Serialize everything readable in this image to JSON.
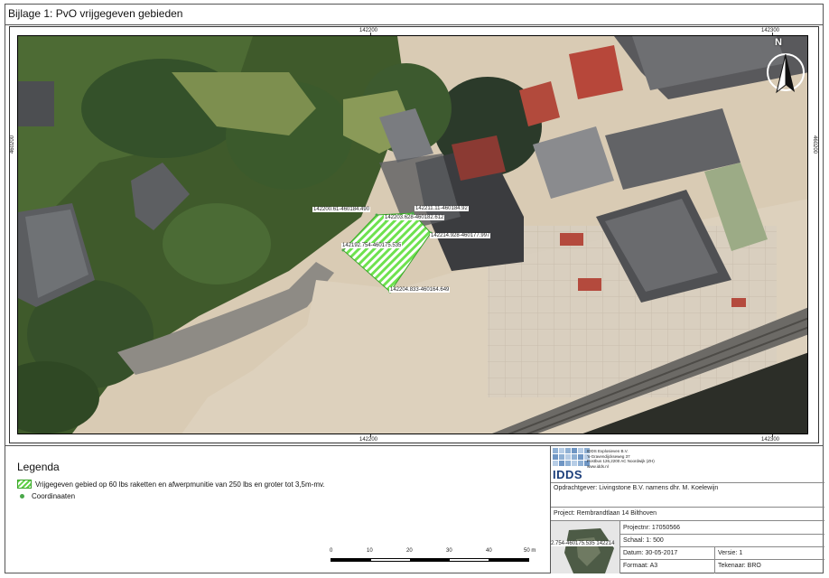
{
  "title": "Bijlage 1: PvO vrijgegeven gebieden",
  "map": {
    "grid_top": [
      "142200",
      "142300"
    ],
    "grid_bottom": [
      "142200",
      "142300"
    ],
    "grid_left": "460200",
    "grid_right": "460200",
    "north_label": "N",
    "points": [
      {
        "label": "142200.61-460184.490"
      },
      {
        "label": "142211.11-460184.92"
      },
      {
        "label": "142203.628-460182.612"
      },
      {
        "label": "142214.928-460177.997"
      },
      {
        "label": "142192.754-460175.535"
      },
      {
        "label": "142204.833-460164.649"
      }
    ],
    "area_color": "#6ee24f"
  },
  "legend": {
    "title": "Legenda",
    "items": [
      {
        "label": "Vrijgegeven gebied op 60 lbs raketten en afwerpmunitie van 250 lbs en groter tot 3,5m-mv.",
        "symbol": "green-hatch"
      },
      {
        "label": "Coordinaaten",
        "symbol": "green-dot"
      }
    ]
  },
  "scale_bar": {
    "ticks": [
      "0",
      "10",
      "20",
      "30",
      "40",
      "50 m"
    ]
  },
  "title_block": {
    "logo_text": "IDDS",
    "company_lines": [
      "IDDS Explosieven B.V.",
      "'s-Gravendijckseweg 37",
      "Postbus 126,2200 AC Noordwijk (ZH)",
      "www.idds.nl"
    ],
    "opdrachtgever": "Opdrachtgever: Livingstone B.V. namens dhr. M. Koelewijn",
    "project": "Project: Rembrandtlaan 14 Bilthoven",
    "inset_text": "2.754-460175.535 142214",
    "projectnr": "Projectnr: 17050566",
    "schaal": "Schaal: 1: 500",
    "datum": "Datum: 30-05-2017",
    "versie": "Versie: 1",
    "formaat": "Formaat: A3",
    "tekenaar": "Tekenaar: BRO"
  }
}
